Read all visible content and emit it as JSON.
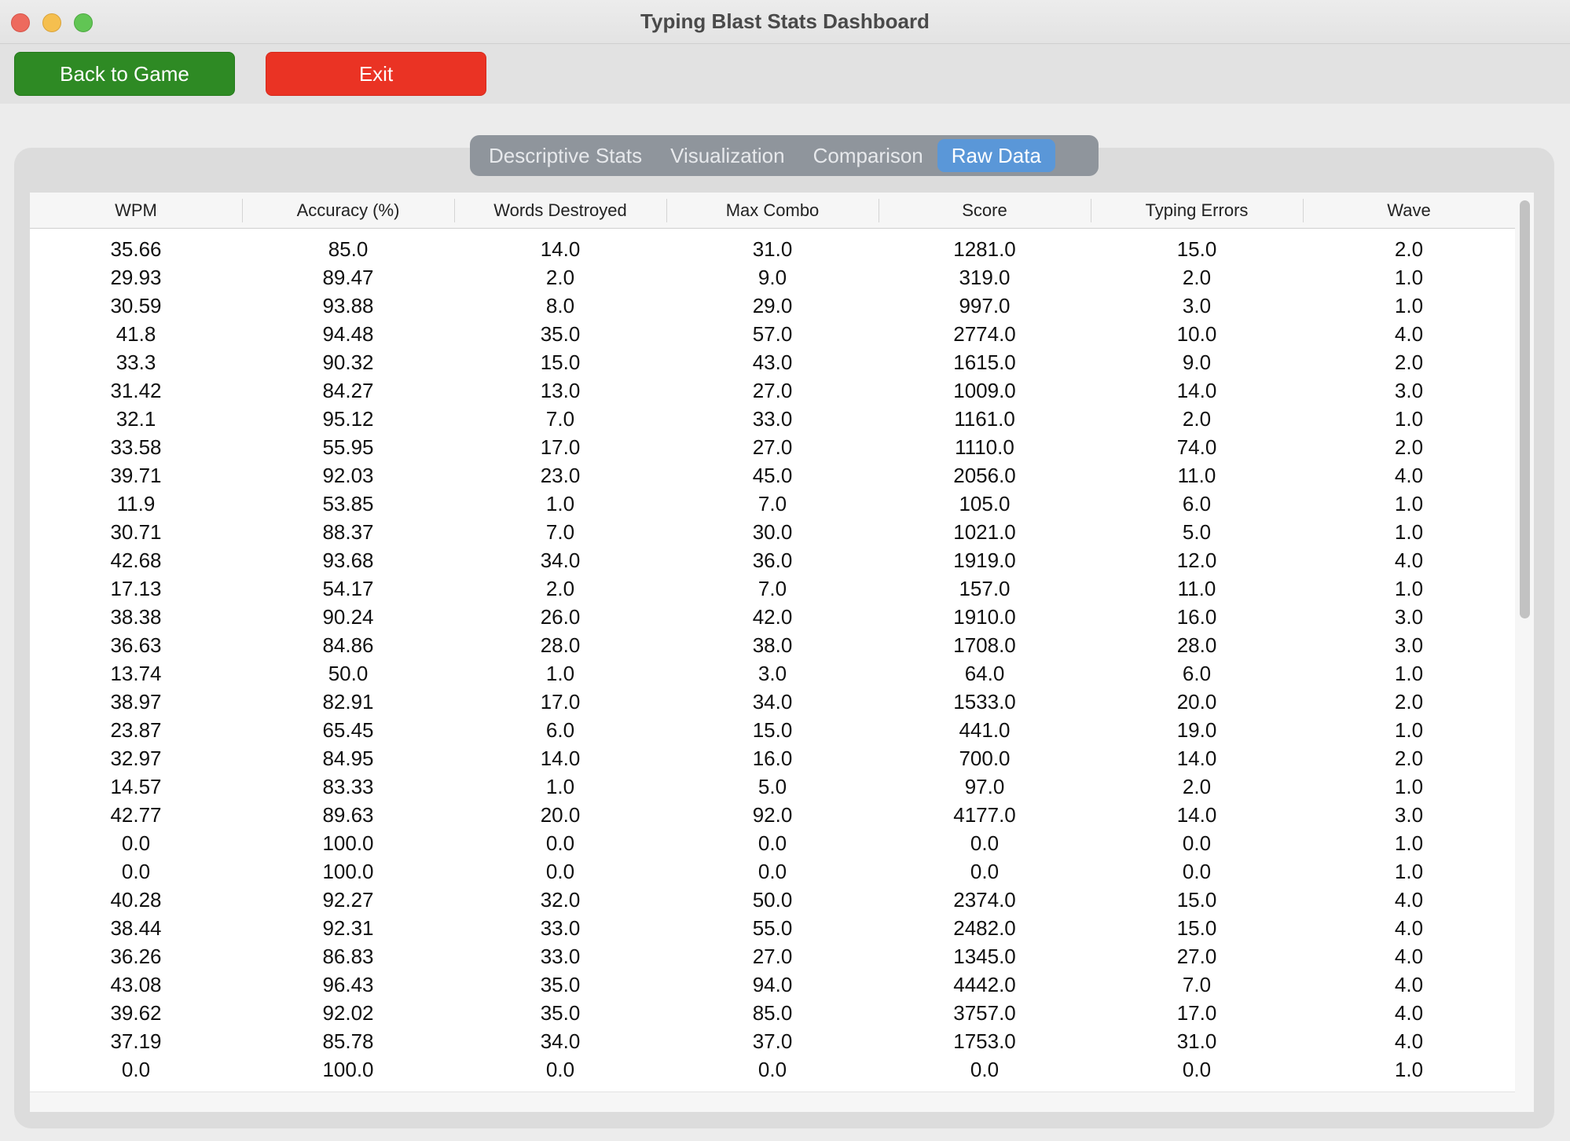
{
  "window": {
    "title": "Typing Blast Stats Dashboard"
  },
  "toolbar": {
    "back_label": "Back to Game",
    "exit_label": "Exit"
  },
  "tabs": [
    {
      "label": "Descriptive Stats",
      "active": false
    },
    {
      "label": "Visualization",
      "active": false
    },
    {
      "label": "Comparison",
      "active": false
    },
    {
      "label": "Raw Data",
      "active": true
    }
  ],
  "table": {
    "columns": [
      "WPM",
      "Accuracy (%)",
      "Words Destroyed",
      "Max Combo",
      "Score",
      "Typing Errors",
      "Wave"
    ],
    "rows": [
      [
        "35.66",
        "85.0",
        "14.0",
        "31.0",
        "1281.0",
        "15.0",
        "2.0"
      ],
      [
        "29.93",
        "89.47",
        "2.0",
        "9.0",
        "319.0",
        "2.0",
        "1.0"
      ],
      [
        "30.59",
        "93.88",
        "8.0",
        "29.0",
        "997.0",
        "3.0",
        "1.0"
      ],
      [
        "41.8",
        "94.48",
        "35.0",
        "57.0",
        "2774.0",
        "10.0",
        "4.0"
      ],
      [
        "33.3",
        "90.32",
        "15.0",
        "43.0",
        "1615.0",
        "9.0",
        "2.0"
      ],
      [
        "31.42",
        "84.27",
        "13.0",
        "27.0",
        "1009.0",
        "14.0",
        "3.0"
      ],
      [
        "32.1",
        "95.12",
        "7.0",
        "33.0",
        "1161.0",
        "2.0",
        "1.0"
      ],
      [
        "33.58",
        "55.95",
        "17.0",
        "27.0",
        "1110.0",
        "74.0",
        "2.0"
      ],
      [
        "39.71",
        "92.03",
        "23.0",
        "45.0",
        "2056.0",
        "11.0",
        "4.0"
      ],
      [
        "11.9",
        "53.85",
        "1.0",
        "7.0",
        "105.0",
        "6.0",
        "1.0"
      ],
      [
        "30.71",
        "88.37",
        "7.0",
        "30.0",
        "1021.0",
        "5.0",
        "1.0"
      ],
      [
        "42.68",
        "93.68",
        "34.0",
        "36.0",
        "1919.0",
        "12.0",
        "4.0"
      ],
      [
        "17.13",
        "54.17",
        "2.0",
        "7.0",
        "157.0",
        "11.0",
        "1.0"
      ],
      [
        "38.38",
        "90.24",
        "26.0",
        "42.0",
        "1910.0",
        "16.0",
        "3.0"
      ],
      [
        "36.63",
        "84.86",
        "28.0",
        "38.0",
        "1708.0",
        "28.0",
        "3.0"
      ],
      [
        "13.74",
        "50.0",
        "1.0",
        "3.0",
        "64.0",
        "6.0",
        "1.0"
      ],
      [
        "38.97",
        "82.91",
        "17.0",
        "34.0",
        "1533.0",
        "20.0",
        "2.0"
      ],
      [
        "23.87",
        "65.45",
        "6.0",
        "15.0",
        "441.0",
        "19.0",
        "1.0"
      ],
      [
        "32.97",
        "84.95",
        "14.0",
        "16.0",
        "700.0",
        "14.0",
        "2.0"
      ],
      [
        "14.57",
        "83.33",
        "1.0",
        "5.0",
        "97.0",
        "2.0",
        "1.0"
      ],
      [
        "42.77",
        "89.63",
        "20.0",
        "92.0",
        "4177.0",
        "14.0",
        "3.0"
      ],
      [
        "0.0",
        "100.0",
        "0.0",
        "0.0",
        "0.0",
        "0.0",
        "1.0"
      ],
      [
        "0.0",
        "100.0",
        "0.0",
        "0.0",
        "0.0",
        "0.0",
        "1.0"
      ],
      [
        "40.28",
        "92.27",
        "32.0",
        "50.0",
        "2374.0",
        "15.0",
        "4.0"
      ],
      [
        "38.44",
        "92.31",
        "33.0",
        "55.0",
        "2482.0",
        "15.0",
        "4.0"
      ],
      [
        "36.26",
        "86.83",
        "33.0",
        "27.0",
        "1345.0",
        "27.0",
        "4.0"
      ],
      [
        "43.08",
        "96.43",
        "35.0",
        "94.0",
        "4442.0",
        "7.0",
        "4.0"
      ],
      [
        "39.62",
        "92.02",
        "35.0",
        "85.0",
        "3757.0",
        "17.0",
        "4.0"
      ],
      [
        "37.19",
        "85.78",
        "34.0",
        "37.0",
        "1753.0",
        "31.0",
        "4.0"
      ],
      [
        "0.0",
        "100.0",
        "0.0",
        "0.0",
        "0.0",
        "0.0",
        "1.0"
      ]
    ]
  },
  "colors": {
    "back_button": "#2e8a24",
    "exit_button": "#ea3324",
    "active_tab": "#5a97d8",
    "tab_bar": "#8f959c"
  }
}
